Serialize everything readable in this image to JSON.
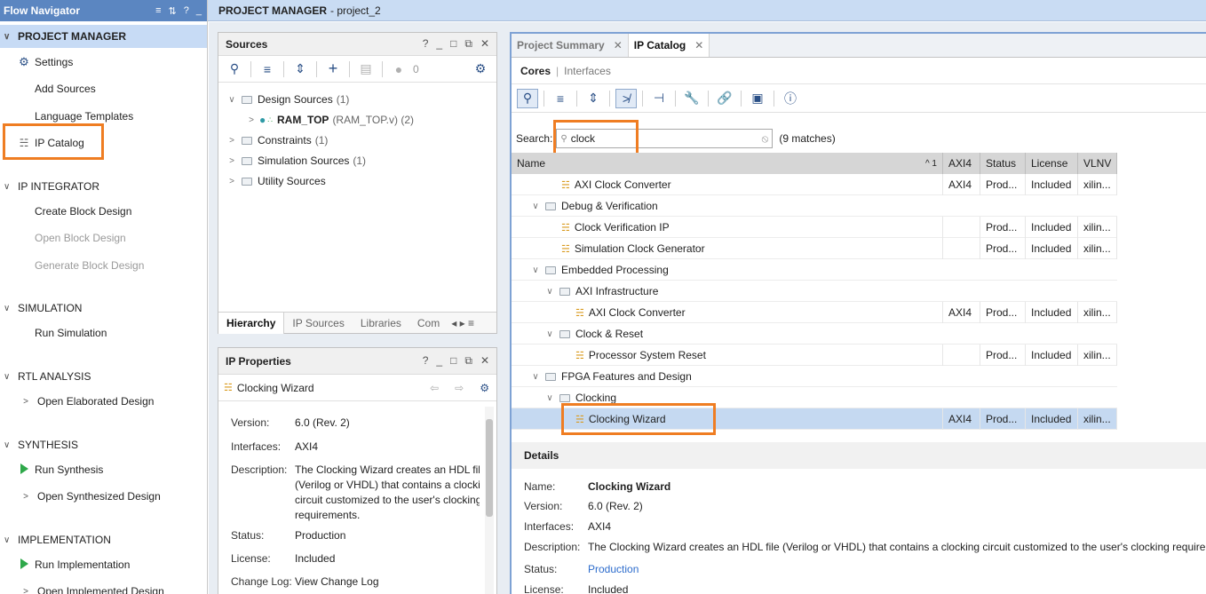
{
  "flow_nav": {
    "title": "Flow Navigator",
    "sections": {
      "project_manager": "PROJECT MANAGER",
      "ip_integrator": "IP INTEGRATOR",
      "simulation": "SIMULATION",
      "rtl_analysis": "RTL ANALYSIS",
      "synthesis": "SYNTHESIS",
      "implementation": "IMPLEMENTATION"
    },
    "items": {
      "settings": "Settings",
      "add_sources": "Add Sources",
      "language_templates": "Language Templates",
      "ip_catalog": "IP Catalog",
      "create_block_design": "Create Block Design",
      "open_block_design": "Open Block Design",
      "generate_block_design": "Generate Block Design",
      "run_simulation": "Run Simulation",
      "open_elaborated_design": "Open Elaborated Design",
      "run_synthesis": "Run Synthesis",
      "open_synthesized_design": "Open Synthesized Design",
      "run_implementation": "Run Implementation",
      "open_implemented_design": "Open Implemented Design"
    }
  },
  "header": {
    "title": "PROJECT MANAGER",
    "project": "- project_2"
  },
  "sources": {
    "title": "Sources",
    "count": "0",
    "design_sources": "Design Sources",
    "design_sources_count": "(1)",
    "ram_top": "RAM_TOP",
    "ram_top_file": "(RAM_TOP.v) (2)",
    "constraints": "Constraints",
    "constraints_count": "(1)",
    "simulation_sources": "Simulation Sources",
    "simulation_sources_count": "(1)",
    "utility_sources": "Utility Sources",
    "tabs": [
      "Hierarchy",
      "IP Sources",
      "Libraries",
      "Com"
    ]
  },
  "ip_properties": {
    "title": "IP Properties",
    "selected": "Clocking Wizard",
    "version_label": "Version:",
    "version": "6.0 (Rev. 2)",
    "interfaces_label": "Interfaces:",
    "interfaces": "AXI4",
    "description_label": "Description:",
    "description_lines": [
      "The Clocking Wizard creates an HDL file",
      "(Verilog or VHDL) that contains a clockin",
      "circuit customized to the user's clocking",
      "requirements."
    ],
    "status_label": "Status:",
    "status": "Production",
    "license_label": "License:",
    "license": "Included",
    "changelog_label": "Change Log:",
    "changelog": "View Change Log"
  },
  "ip_catalog": {
    "tabs": {
      "summary": "Project Summary",
      "catalog": "IP Catalog"
    },
    "subtabs": {
      "cores": "Cores",
      "interfaces": "Interfaces"
    },
    "search_label": "Search:",
    "search_value": "clock",
    "matches": "(9 matches)",
    "columns": {
      "name": "Name",
      "sort": "^ 1",
      "axi4": "AXI4",
      "status": "Status",
      "license": "License",
      "vlnv": "VLNV"
    },
    "rows": [
      {
        "name": "AXI Clock Converter",
        "axi4": "AXI4",
        "status": "Prod...",
        "license": "Included",
        "vlnv": "xilin..."
      },
      {
        "name": "Debug & Verification"
      },
      {
        "name": "Clock Verification IP",
        "axi4": "",
        "status": "Prod...",
        "license": "Included",
        "vlnv": "xilin..."
      },
      {
        "name": "Simulation Clock Generator",
        "axi4": "",
        "status": "Prod...",
        "license": "Included",
        "vlnv": "xilin..."
      },
      {
        "name": "Embedded Processing"
      },
      {
        "name": "AXI Infrastructure"
      },
      {
        "name": "AXI Clock Converter",
        "axi4": "AXI4",
        "status": "Prod...",
        "license": "Included",
        "vlnv": "xilin..."
      },
      {
        "name": "Clock & Reset"
      },
      {
        "name": "Processor System Reset",
        "axi4": "",
        "status": "Prod...",
        "license": "Included",
        "vlnv": "xilin..."
      },
      {
        "name": "FPGA Features and Design"
      },
      {
        "name": "Clocking"
      },
      {
        "name": "Clocking Wizard",
        "axi4": "AXI4",
        "status": "Prod...",
        "license": "Included",
        "vlnv": "xilin..."
      }
    ],
    "details": {
      "title": "Details",
      "name_label": "Name:",
      "name": "Clocking Wizard",
      "version_label": "Version:",
      "version": "6.0 (Rev. 2)",
      "interfaces_label": "Interfaces:",
      "interfaces": "AXI4",
      "description_label": "Description:",
      "description": "The Clocking Wizard creates an HDL file (Verilog or VHDL) that contains a clocking circuit customized to the user's clocking requireme",
      "status_label": "Status:",
      "status": "Production",
      "license_label": "License:",
      "license": "Included"
    }
  },
  "colors": {
    "accent": "#5b86c1",
    "highlight": "#ef7d22",
    "selected_row": "#c5d9f1",
    "link": "#2d6ccc"
  }
}
